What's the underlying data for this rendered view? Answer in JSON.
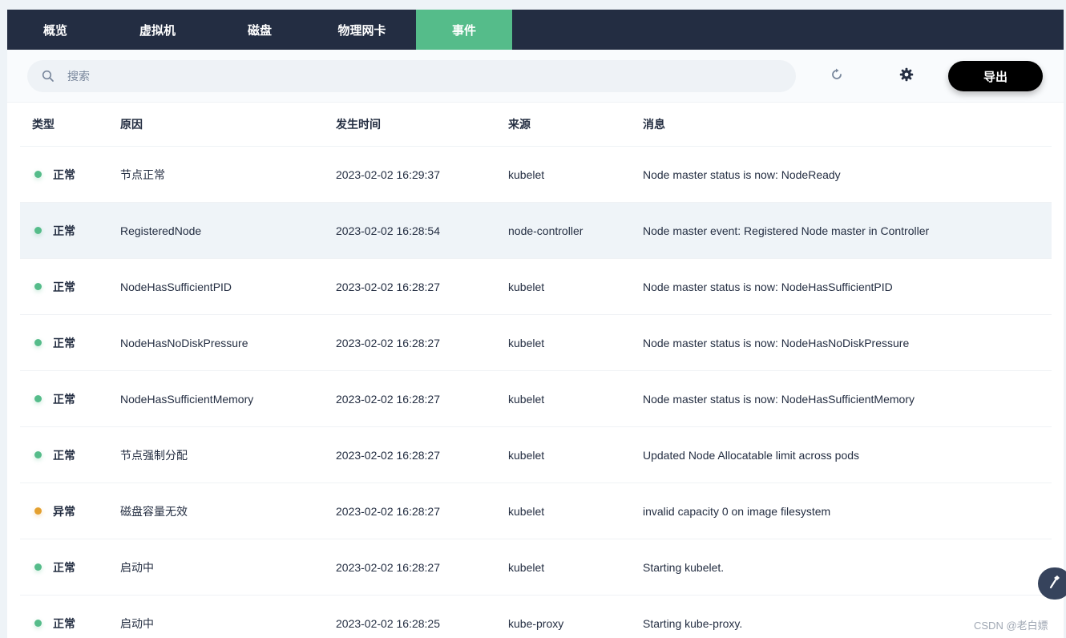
{
  "tabs": [
    {
      "label": "概览",
      "active": false
    },
    {
      "label": "虚拟机",
      "active": false
    },
    {
      "label": "磁盘",
      "active": false
    },
    {
      "label": "物理网卡",
      "active": false
    },
    {
      "label": "事件",
      "active": true
    }
  ],
  "toolbar": {
    "search_placeholder": "搜索",
    "export_label": "导出",
    "icons": [
      "search-icon",
      "refresh-icon",
      "gear-icon"
    ]
  },
  "table": {
    "headers": [
      "类型",
      "原因",
      "发生时间",
      "来源",
      "消息"
    ],
    "rows": [
      {
        "type": "正常",
        "status": "normal",
        "reason": "节点正常",
        "time": "2023-02-02 16:29:37",
        "source": "kubelet",
        "message": "Node master status is now: NodeReady"
      },
      {
        "type": "正常",
        "status": "normal",
        "reason": "RegisteredNode",
        "time": "2023-02-02 16:28:54",
        "source": "node-controller",
        "message": "Node master event: Registered Node master in Controller"
      },
      {
        "type": "正常",
        "status": "normal",
        "reason": "NodeHasSufficientPID",
        "time": "2023-02-02 16:28:27",
        "source": "kubelet",
        "message": "Node master status is now: NodeHasSufficientPID"
      },
      {
        "type": "正常",
        "status": "normal",
        "reason": "NodeHasNoDiskPressure",
        "time": "2023-02-02 16:28:27",
        "source": "kubelet",
        "message": "Node master status is now: NodeHasNoDiskPressure"
      },
      {
        "type": "正常",
        "status": "normal",
        "reason": "NodeHasSufficientMemory",
        "time": "2023-02-02 16:28:27",
        "source": "kubelet",
        "message": "Node master status is now: NodeHasSufficientMemory"
      },
      {
        "type": "正常",
        "status": "normal",
        "reason": "节点强制分配",
        "time": "2023-02-02 16:28:27",
        "source": "kubelet",
        "message": "Updated Node Allocatable limit across pods"
      },
      {
        "type": "异常",
        "status": "warning",
        "reason": "磁盘容量无效",
        "time": "2023-02-02 16:28:27",
        "source": "kubelet",
        "message": "invalid capacity 0 on image filesystem"
      },
      {
        "type": "正常",
        "status": "normal",
        "reason": "启动中",
        "time": "2023-02-02 16:28:27",
        "source": "kubelet",
        "message": "Starting kubelet."
      },
      {
        "type": "正常",
        "status": "normal",
        "reason": "启动中",
        "time": "2023-02-02 16:28:25",
        "source": "kube-proxy",
        "message": "Starting kube-proxy."
      }
    ]
  },
  "colors": {
    "normal": "#55bc8a",
    "warning": "#e4a02f",
    "tab_active": "#55bc8a",
    "tabbar": "#232d42"
  },
  "watermark": "CSDN @老白嫖",
  "float_icon": "hammer-icon"
}
